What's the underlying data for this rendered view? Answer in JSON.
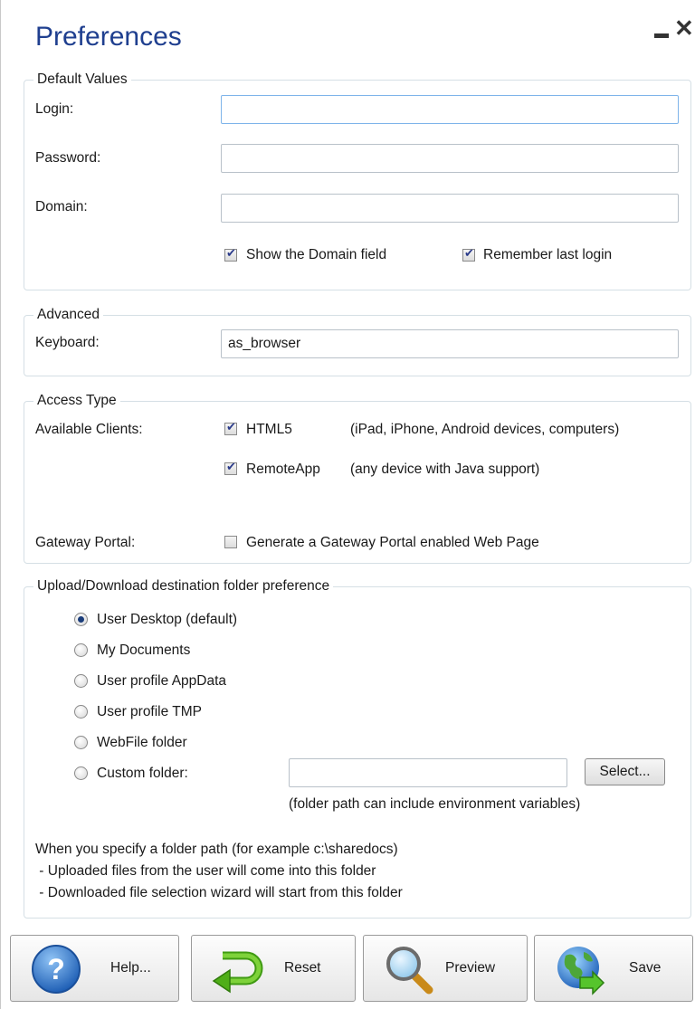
{
  "window": {
    "title": "Preferences"
  },
  "default_values": {
    "legend": "Default Values",
    "login_label": "Login:",
    "login_value": "",
    "password_label": "Password:",
    "password_value": "",
    "domain_label": "Domain:",
    "domain_value": "",
    "show_domain": {
      "label": "Show the Domain field",
      "checked": true
    },
    "remember_login": {
      "label": "Remember last login",
      "checked": true
    }
  },
  "advanced": {
    "legend": "Advanced",
    "keyboard_label": "Keyboard:",
    "keyboard_value": "as_browser"
  },
  "access_type": {
    "legend": "Access Type",
    "clients_label": "Available Clients:",
    "html5": {
      "label": "HTML5",
      "desc": "(iPad, iPhone, Android devices, computers)",
      "checked": true
    },
    "remoteapp": {
      "label": "RemoteApp",
      "desc": "(any device with Java support)",
      "checked": true
    },
    "gateway_label": "Gateway Portal:",
    "gateway_option": {
      "label": "Generate a Gateway Portal enabled Web Page",
      "checked": false
    }
  },
  "upload_download": {
    "legend": "Upload/Download destination folder preference",
    "options": [
      "User Desktop (default)",
      "My Documents",
      "User profile AppData",
      "User profile TMP",
      "WebFile folder",
      "Custom folder:"
    ],
    "selected": "User Desktop (default)",
    "custom_path": "",
    "select_button": "Select...",
    "hint": "(folder path can include environment variables)",
    "note_line1": "When you specify a folder path (for example c:\\sharedocs)",
    "note_line2": " - Uploaded files from the user will come into this folder",
    "note_line3": " - Downloaded file selection wizard will start from this folder"
  },
  "buttons": {
    "help": "Help...",
    "reset": "Reset",
    "preview": "Preview",
    "save": "Save"
  },
  "colors": {
    "title": "#1f3f8f",
    "group_border": "#d5dfe5",
    "focus_border": "#7eb4ea"
  }
}
